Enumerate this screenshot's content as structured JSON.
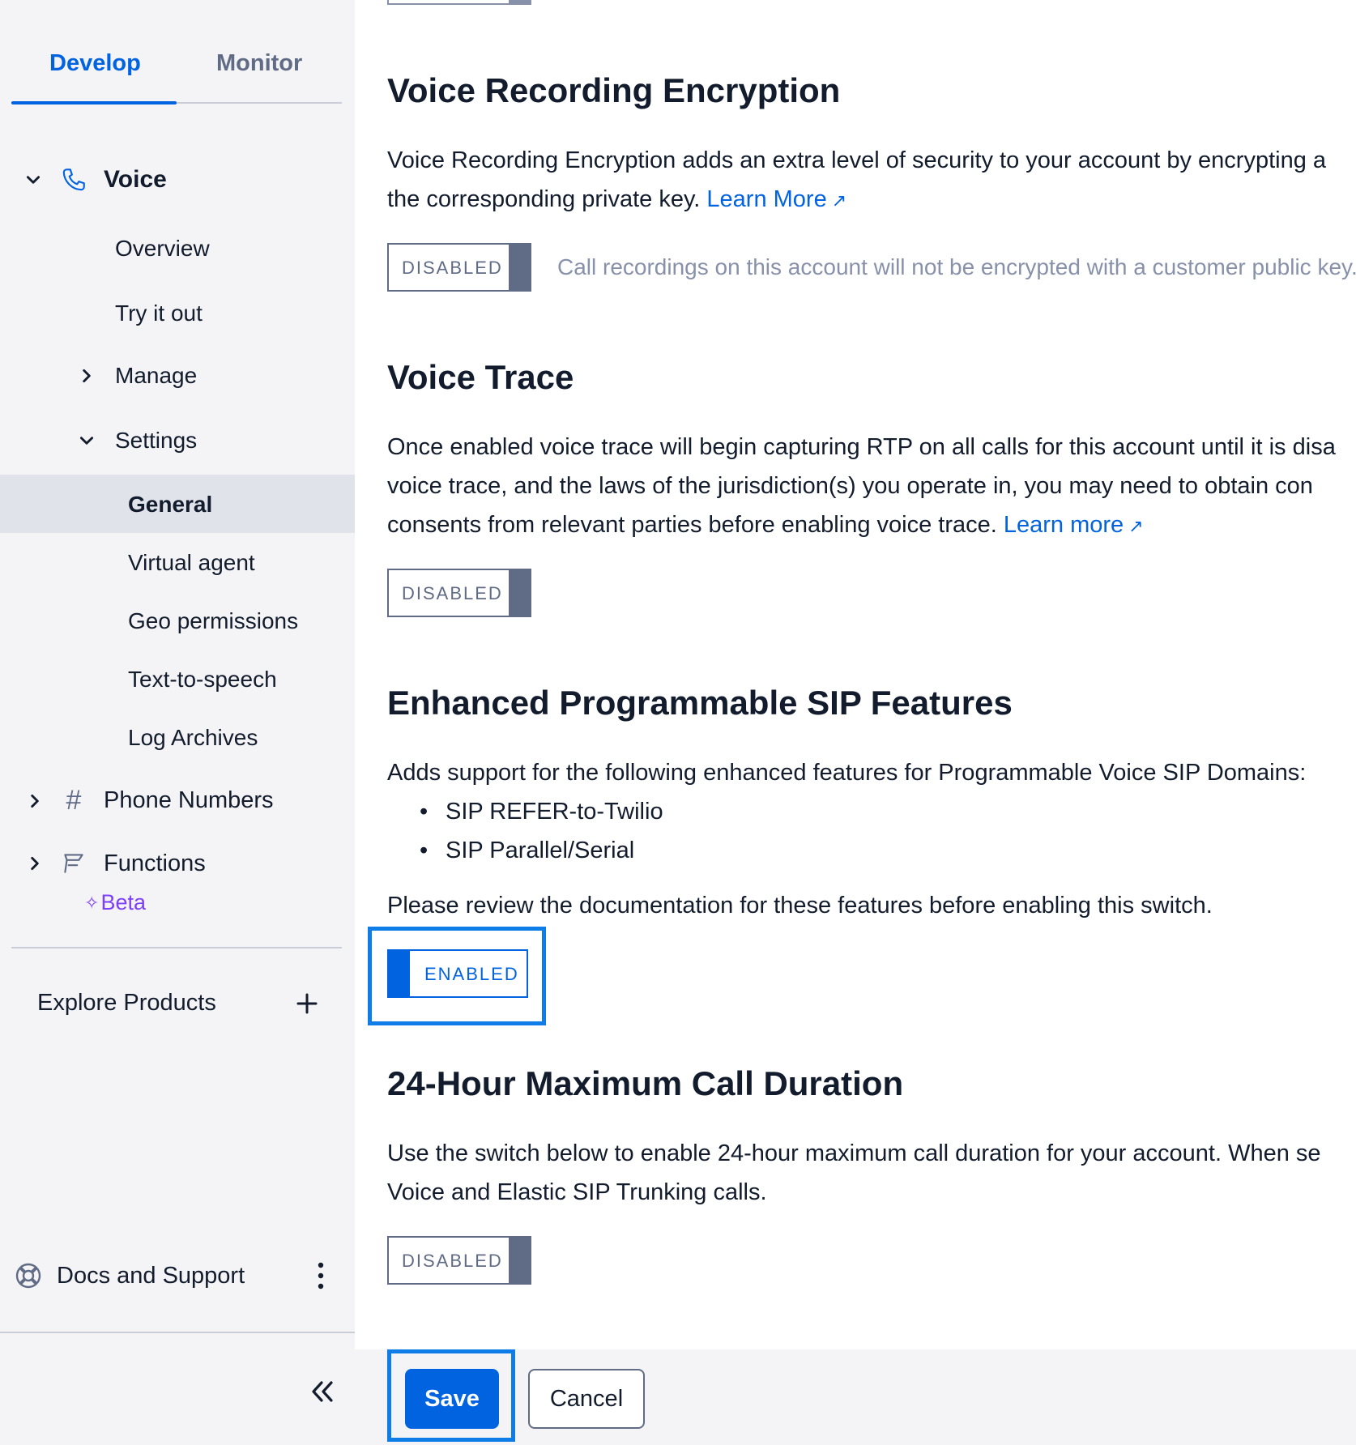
{
  "sidebar": {
    "tabs": [
      {
        "label": "Develop",
        "active": true
      },
      {
        "label": "Monitor",
        "active": false
      }
    ],
    "voice": {
      "label": "Voice",
      "items": {
        "overview": "Overview",
        "try_it_out": "Try it out",
        "manage": "Manage",
        "settings": "Settings",
        "settings_items": [
          "General",
          "Virtual agent",
          "Geo permissions",
          "Text-to-speech",
          "Log Archives"
        ]
      }
    },
    "phone_numbers": "Phone Numbers",
    "functions": "Functions",
    "functions_badge": "Beta",
    "explore_products": "Explore Products",
    "docs_support": "Docs and Support"
  },
  "main": {
    "recording_encryption": {
      "title": "Voice Recording Encryption",
      "line1": "Voice Recording Encryption adds an extra level of security to your account by encrypting a",
      "line2": "the corresponding private key.",
      "link": "Learn More",
      "toggle": "DISABLED",
      "note": "Call recordings on this account will not be encrypted with a customer public key."
    },
    "voice_trace": {
      "title": "Voice Trace",
      "line1": "Once enabled voice trace will begin capturing RTP on all calls for this account until it is disa",
      "line2": "voice trace, and the laws of the jurisdiction(s) you operate in, you may need to obtain con",
      "line3": "consents from relevant parties before enabling voice trace.",
      "link": "Learn more",
      "toggle": "DISABLED"
    },
    "sip_features": {
      "title": "Enhanced Programmable SIP Features",
      "intro": "Adds support for the following enhanced features for Programmable Voice SIP Domains:",
      "bullets": [
        "SIP REFER-to-Twilio",
        "SIP Parallel/Serial"
      ],
      "review": "Please review the documentation for these features before enabling this switch.",
      "toggle": "ENABLED"
    },
    "max_duration": {
      "title": "24-Hour Maximum Call Duration",
      "line1": "Use the switch below to enable 24-hour maximum call duration for your account. When se",
      "line2": "Voice and Elastic SIP Trunking calls.",
      "toggle": "DISABLED"
    },
    "footer": {
      "save": "Save",
      "cancel": "Cancel"
    }
  },
  "colors": {
    "accent": "#0263e0",
    "focus": "#0e7de8",
    "beta": "#7d3ff8"
  }
}
